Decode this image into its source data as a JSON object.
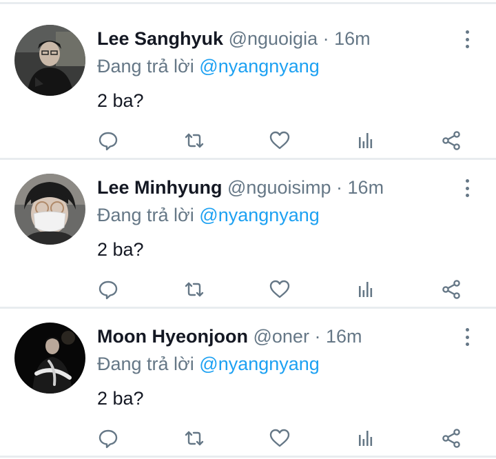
{
  "tweets": [
    {
      "name": "Lee Sanghyuk",
      "handle": "@nguoigia",
      "separator": "·",
      "time": "16m",
      "reply_prefix": "Đang trả lời",
      "reply_to": "@nyangnyang",
      "text": "2 ba?"
    },
    {
      "name": "Lee Minhyung",
      "handle": "@nguoisimp",
      "separator": "·",
      "time": "16m",
      "reply_prefix": "Đang trả lời",
      "reply_to": "@nyangnyang",
      "text": "2 ba?"
    },
    {
      "name": "Moon Hyeonjoon",
      "handle": "@oner",
      "separator": "·",
      "time": "16m",
      "reply_prefix": "Đang trả lời",
      "reply_to": "@nyangnyang",
      "text": "2 ba?"
    }
  ],
  "icons": {
    "reply": "reply-icon",
    "retweet": "retweet-icon",
    "like": "heart-icon",
    "analytics": "analytics-icon",
    "share": "share-icon",
    "more": "more-vertical-icon"
  },
  "colors": {
    "link": "#1da1f2",
    "secondary_text": "#657786",
    "primary_text": "#141823",
    "separator": "#e8ecef"
  }
}
